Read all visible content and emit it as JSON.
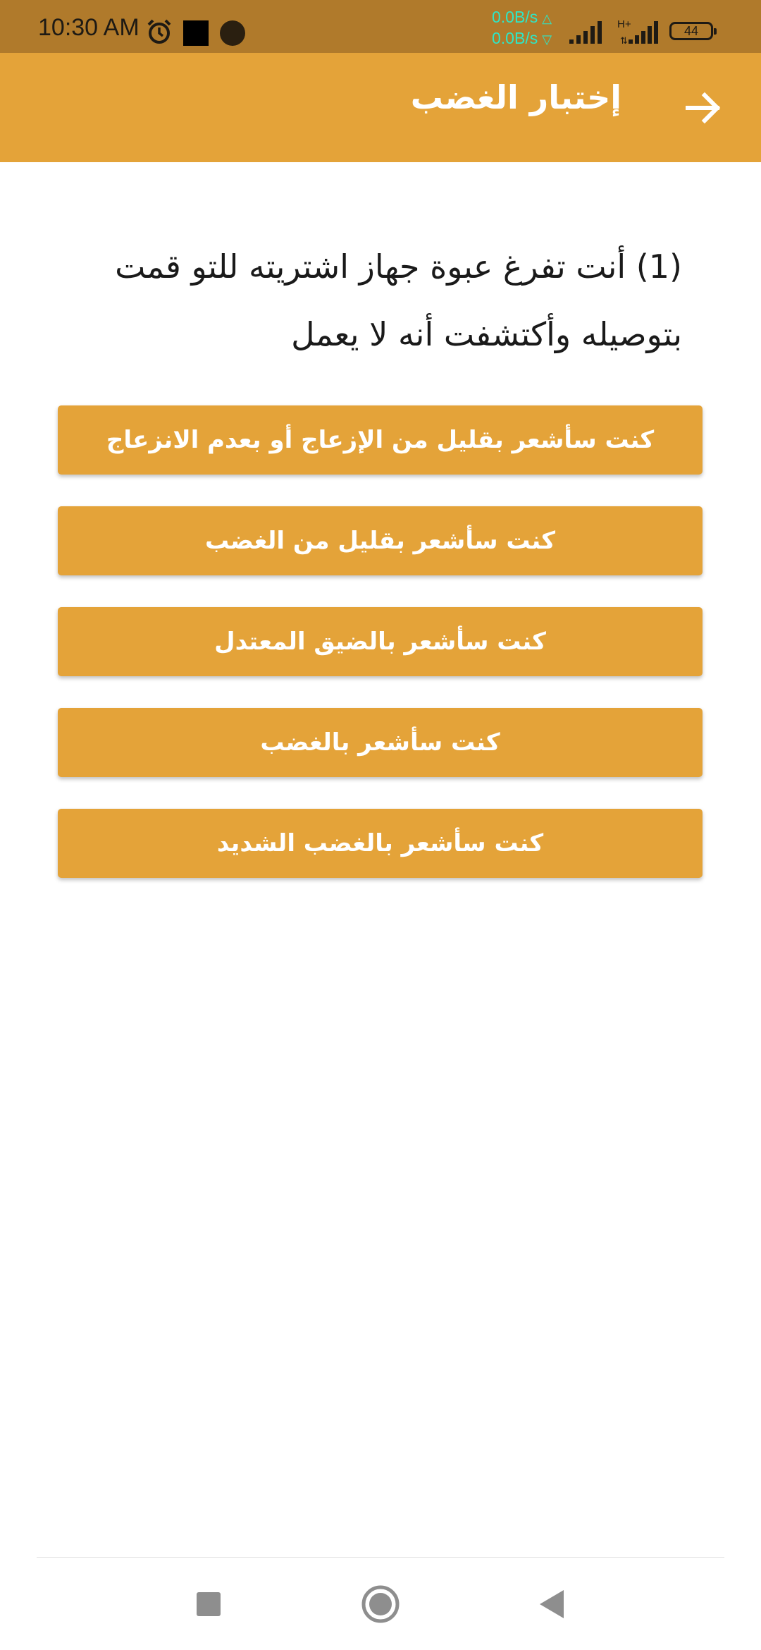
{
  "status_bar": {
    "time": "10:30 AM",
    "net_up": "0.0B/s",
    "net_down": "0.0B/s",
    "network_type": "H+",
    "battery": "44",
    "icons": [
      "alarm-icon",
      "square-notification-icon",
      "circle-notification-icon",
      "signal-icon",
      "signal-icon-2"
    ]
  },
  "app_bar": {
    "title": "إختبار الغضب",
    "back_icon": "arrow-right-icon"
  },
  "question": {
    "text": "(1) أنت تفرغ عبوة جهاز اشتريته للتو قمت بتوصيله وأكتشفت أنه لا يعمل"
  },
  "options": [
    {
      "label": "كنت سأشعر بقليل من الإزعاج أو بعدم الانزعاج"
    },
    {
      "label": "كنت سأشعر بقليل من الغضب"
    },
    {
      "label": "كنت سأشعر بالضيق المعتدل"
    },
    {
      "label": "كنت سأشعر بالغضب"
    },
    {
      "label": "كنت سأشعر بالغضب الشديد"
    }
  ],
  "nav_bar": {
    "icons": [
      "recent-apps-icon",
      "home-icon",
      "back-icon"
    ]
  },
  "colors": {
    "status_bar": "#b07a2b",
    "accent": "#e4a339",
    "speed_text": "#2ee6c6"
  }
}
